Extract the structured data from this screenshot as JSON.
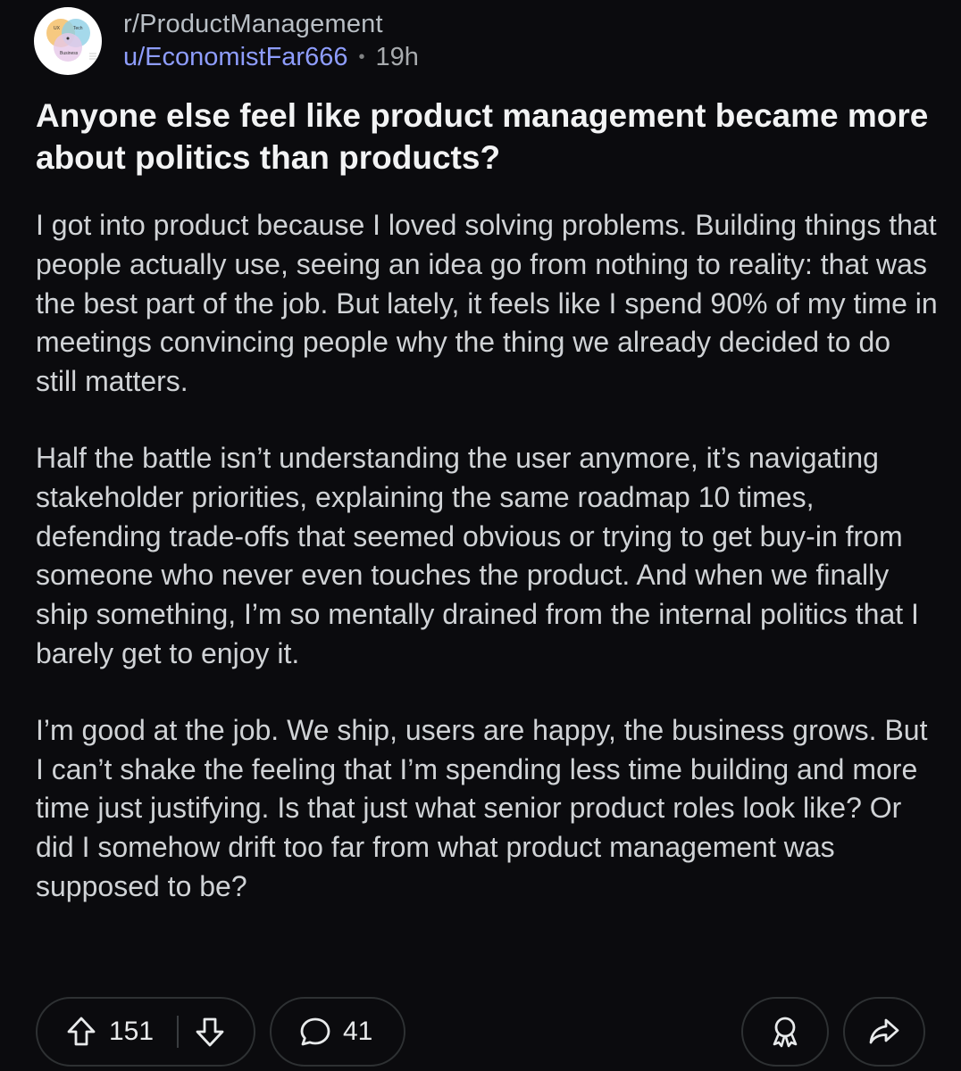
{
  "post": {
    "subreddit": "r/ProductManagement",
    "author": "u/EconomistFar666",
    "separator": "•",
    "age": "19h",
    "title": "Anyone else feel like product management became more about politics than products?",
    "paragraphs": [
      "I got into product because I loved solving problems. Building things that people actually use, seeing an idea go from nothing to reality: that was the best part of the job. But lately, it feels like I spend 90% of my time in meetings convincing people why the thing we already decided to do still matters.",
      "Half the battle isn’t understanding the user anymore, it’s navigating stakeholder priorities, explaining the same roadmap 10 times, defending trade-offs that seemed obvious or trying to get buy-in from someone who never even touches the product. And when we finally ship something, I’m so mentally drained from the internal politics that I barely get to enjoy it.",
      "I’m good at the job. We ship, users are happy, the business grows. But I can’t shake the feeling that I’m spending less time building and more time just justifying. Is that just what senior product roles look like? Or did I somehow drift too far from what product management was supposed to be?"
    ]
  },
  "avatar": {
    "labels": [
      "UX",
      "Tech",
      "Business"
    ]
  },
  "actions": {
    "upvotes": "151",
    "comments": "41",
    "icons": [
      "upvote-icon",
      "downvote-icon",
      "comment-icon",
      "award-icon",
      "share-icon"
    ]
  },
  "colors": {
    "background": "#0b0b0e",
    "username": "#8e9dfd",
    "title": "#f2f3f4",
    "pill_border": "#2e3133"
  }
}
